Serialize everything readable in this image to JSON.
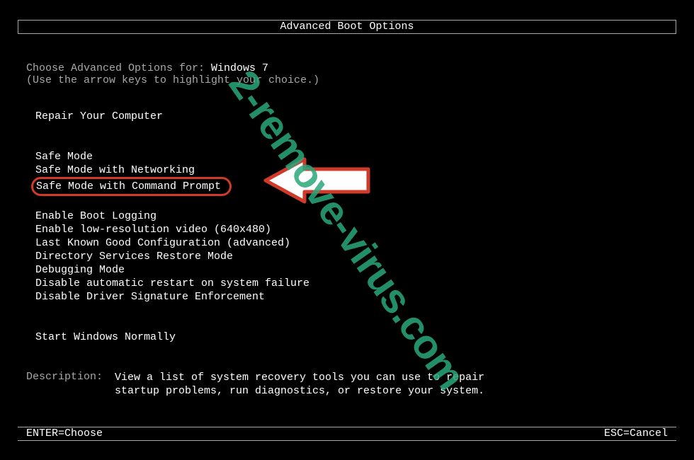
{
  "title": "Advanced Boot Options",
  "prompt": {
    "prefix": "Choose Advanced Options for: ",
    "os": "Windows 7"
  },
  "hint": "(Use the arrow keys to highlight your choice.)",
  "menu": {
    "repair": "Repair Your Computer",
    "safe_mode": "Safe Mode",
    "safe_mode_net": "Safe Mode with Networking",
    "safe_mode_cmd": "Safe Mode with Command Prompt",
    "boot_logging": "Enable Boot Logging",
    "low_res": "Enable low-resolution video (640x480)",
    "lkgc": "Last Known Good Configuration (advanced)",
    "dsrm": "Directory Services Restore Mode",
    "debug": "Debugging Mode",
    "no_auto_restart": "Disable automatic restart on system failure",
    "no_drv_sig": "Disable Driver Signature Enforcement",
    "start_normal": "Start Windows Normally"
  },
  "description": {
    "label": "Description:",
    "line1": "View a list of system recovery tools you can use to repair",
    "line2": "startup problems, run diagnostics, or restore your system."
  },
  "footer": {
    "enter": "ENTER=Choose",
    "esc": "ESC=Cancel"
  },
  "watermark": "2-remove-virus.com"
}
